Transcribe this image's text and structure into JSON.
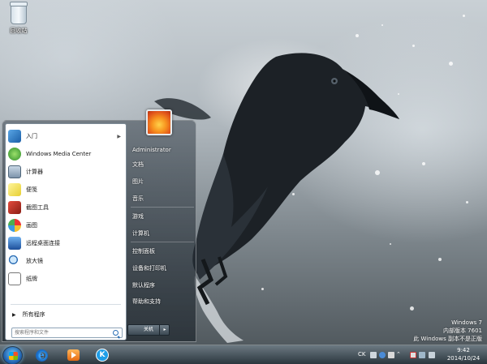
{
  "desktop": {
    "recycle_bin_label": "回收站"
  },
  "start_menu": {
    "programs": [
      {
        "label": "入门",
        "icon": "getting-started-icon",
        "has_submenu": true
      },
      {
        "label": "Windows Media Center",
        "icon": "media-center-icon",
        "has_submenu": false
      },
      {
        "label": "计算器",
        "icon": "calculator-icon",
        "has_submenu": false
      },
      {
        "label": "便笺",
        "icon": "sticky-notes-icon",
        "has_submenu": false
      },
      {
        "label": "截图工具",
        "icon": "snipping-tool-icon",
        "has_submenu": false
      },
      {
        "label": "画图",
        "icon": "paint-icon",
        "has_submenu": false
      },
      {
        "label": "远程桌面连接",
        "icon": "remote-desktop-icon",
        "has_submenu": false
      },
      {
        "label": "放大镜",
        "icon": "magnifier-icon",
        "has_submenu": false
      },
      {
        "label": "纸牌",
        "icon": "solitaire-icon",
        "has_submenu": false
      }
    ],
    "all_programs": "所有程序",
    "search_placeholder": "搜索程序和文件",
    "user_name": "Administrator",
    "right_items": [
      {
        "label": "文档"
      },
      {
        "label": "图片"
      },
      {
        "label": "音乐"
      },
      {
        "label": "游戏"
      },
      {
        "label": "计算机"
      },
      {
        "label": "控制面板"
      },
      {
        "label": "设备和打印机"
      },
      {
        "label": "默认程序"
      },
      {
        "label": "帮助和支持"
      }
    ],
    "shutdown_label": "关机",
    "shutdown_arrow": "▸"
  },
  "taskbar": {
    "tray": {
      "input_method": "CK",
      "time": "9:42",
      "date": "2014/10/24"
    }
  },
  "watermark": {
    "line1": "Windows 7",
    "line2": "内部版本 7601",
    "line3": "此 Windows 副本不是正版"
  },
  "colors": {
    "accent": "#1a5aa8",
    "menu_text": "#1c1c1c"
  }
}
